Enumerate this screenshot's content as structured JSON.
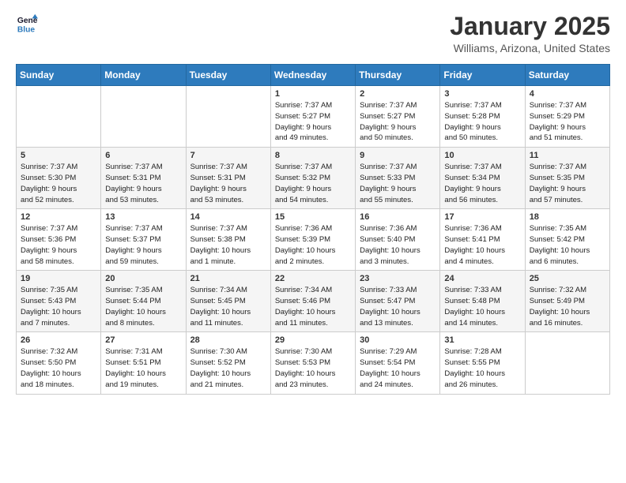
{
  "header": {
    "logo_line1": "General",
    "logo_line2": "Blue",
    "month": "January 2025",
    "location": "Williams, Arizona, United States"
  },
  "days_of_week": [
    "Sunday",
    "Monday",
    "Tuesday",
    "Wednesday",
    "Thursday",
    "Friday",
    "Saturday"
  ],
  "weeks": [
    [
      {
        "day": "",
        "info": ""
      },
      {
        "day": "",
        "info": ""
      },
      {
        "day": "",
        "info": ""
      },
      {
        "day": "1",
        "info": "Sunrise: 7:37 AM\nSunset: 5:27 PM\nDaylight: 9 hours\nand 49 minutes."
      },
      {
        "day": "2",
        "info": "Sunrise: 7:37 AM\nSunset: 5:27 PM\nDaylight: 9 hours\nand 50 minutes."
      },
      {
        "day": "3",
        "info": "Sunrise: 7:37 AM\nSunset: 5:28 PM\nDaylight: 9 hours\nand 50 minutes."
      },
      {
        "day": "4",
        "info": "Sunrise: 7:37 AM\nSunset: 5:29 PM\nDaylight: 9 hours\nand 51 minutes."
      }
    ],
    [
      {
        "day": "5",
        "info": "Sunrise: 7:37 AM\nSunset: 5:30 PM\nDaylight: 9 hours\nand 52 minutes."
      },
      {
        "day": "6",
        "info": "Sunrise: 7:37 AM\nSunset: 5:31 PM\nDaylight: 9 hours\nand 53 minutes."
      },
      {
        "day": "7",
        "info": "Sunrise: 7:37 AM\nSunset: 5:31 PM\nDaylight: 9 hours\nand 53 minutes."
      },
      {
        "day": "8",
        "info": "Sunrise: 7:37 AM\nSunset: 5:32 PM\nDaylight: 9 hours\nand 54 minutes."
      },
      {
        "day": "9",
        "info": "Sunrise: 7:37 AM\nSunset: 5:33 PM\nDaylight: 9 hours\nand 55 minutes."
      },
      {
        "day": "10",
        "info": "Sunrise: 7:37 AM\nSunset: 5:34 PM\nDaylight: 9 hours\nand 56 minutes."
      },
      {
        "day": "11",
        "info": "Sunrise: 7:37 AM\nSunset: 5:35 PM\nDaylight: 9 hours\nand 57 minutes."
      }
    ],
    [
      {
        "day": "12",
        "info": "Sunrise: 7:37 AM\nSunset: 5:36 PM\nDaylight: 9 hours\nand 58 minutes."
      },
      {
        "day": "13",
        "info": "Sunrise: 7:37 AM\nSunset: 5:37 PM\nDaylight: 9 hours\nand 59 minutes."
      },
      {
        "day": "14",
        "info": "Sunrise: 7:37 AM\nSunset: 5:38 PM\nDaylight: 10 hours\nand 1 minute."
      },
      {
        "day": "15",
        "info": "Sunrise: 7:36 AM\nSunset: 5:39 PM\nDaylight: 10 hours\nand 2 minutes."
      },
      {
        "day": "16",
        "info": "Sunrise: 7:36 AM\nSunset: 5:40 PM\nDaylight: 10 hours\nand 3 minutes."
      },
      {
        "day": "17",
        "info": "Sunrise: 7:36 AM\nSunset: 5:41 PM\nDaylight: 10 hours\nand 4 minutes."
      },
      {
        "day": "18",
        "info": "Sunrise: 7:35 AM\nSunset: 5:42 PM\nDaylight: 10 hours\nand 6 minutes."
      }
    ],
    [
      {
        "day": "19",
        "info": "Sunrise: 7:35 AM\nSunset: 5:43 PM\nDaylight: 10 hours\nand 7 minutes."
      },
      {
        "day": "20",
        "info": "Sunrise: 7:35 AM\nSunset: 5:44 PM\nDaylight: 10 hours\nand 8 minutes."
      },
      {
        "day": "21",
        "info": "Sunrise: 7:34 AM\nSunset: 5:45 PM\nDaylight: 10 hours\nand 11 minutes."
      },
      {
        "day": "22",
        "info": "Sunrise: 7:34 AM\nSunset: 5:46 PM\nDaylight: 10 hours\nand 11 minutes."
      },
      {
        "day": "23",
        "info": "Sunrise: 7:33 AM\nSunset: 5:47 PM\nDaylight: 10 hours\nand 13 minutes."
      },
      {
        "day": "24",
        "info": "Sunrise: 7:33 AM\nSunset: 5:48 PM\nDaylight: 10 hours\nand 14 minutes."
      },
      {
        "day": "25",
        "info": "Sunrise: 7:32 AM\nSunset: 5:49 PM\nDaylight: 10 hours\nand 16 minutes."
      }
    ],
    [
      {
        "day": "26",
        "info": "Sunrise: 7:32 AM\nSunset: 5:50 PM\nDaylight: 10 hours\nand 18 minutes."
      },
      {
        "day": "27",
        "info": "Sunrise: 7:31 AM\nSunset: 5:51 PM\nDaylight: 10 hours\nand 19 minutes."
      },
      {
        "day": "28",
        "info": "Sunrise: 7:30 AM\nSunset: 5:52 PM\nDaylight: 10 hours\nand 21 minutes."
      },
      {
        "day": "29",
        "info": "Sunrise: 7:30 AM\nSunset: 5:53 PM\nDaylight: 10 hours\nand 23 minutes."
      },
      {
        "day": "30",
        "info": "Sunrise: 7:29 AM\nSunset: 5:54 PM\nDaylight: 10 hours\nand 24 minutes."
      },
      {
        "day": "31",
        "info": "Sunrise: 7:28 AM\nSunset: 5:55 PM\nDaylight: 10 hours\nand 26 minutes."
      },
      {
        "day": "",
        "info": ""
      }
    ]
  ]
}
